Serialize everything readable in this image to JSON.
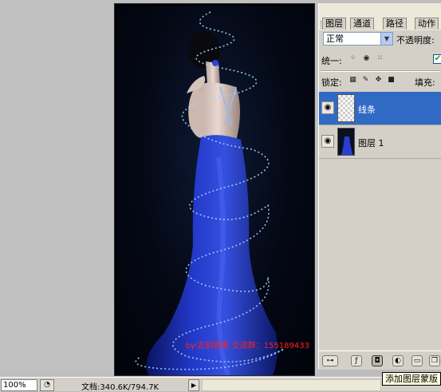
{
  "document": {
    "watermark": "by:古韵香萧 交流群：155189433"
  },
  "status_bar": {
    "zoom": "100%",
    "doc_size": "文档:340.6K/794.7K"
  },
  "tooltip": "添加图层蒙版",
  "layers_panel": {
    "tabs": [
      {
        "label": "图层",
        "active": true
      },
      {
        "label": "通道",
        "active": false
      },
      {
        "label": "路径",
        "active": false
      },
      {
        "label": "动作",
        "active": false
      }
    ],
    "blend_mode": "正常",
    "opacity_label": "不透明度:",
    "unify_label": "统一:",
    "lock_label": "锁定:",
    "fill_label": "填充:",
    "layers": [
      {
        "name": "线条",
        "selected": true,
        "visible": true,
        "thumbnail": "transparent"
      },
      {
        "name": "图层 1",
        "selected": false,
        "visible": true,
        "thumbnail": "photo"
      }
    ]
  },
  "colors": {
    "selection": "#316ac5",
    "watermark": "#ff2020",
    "dress": "#1c2fb0"
  }
}
